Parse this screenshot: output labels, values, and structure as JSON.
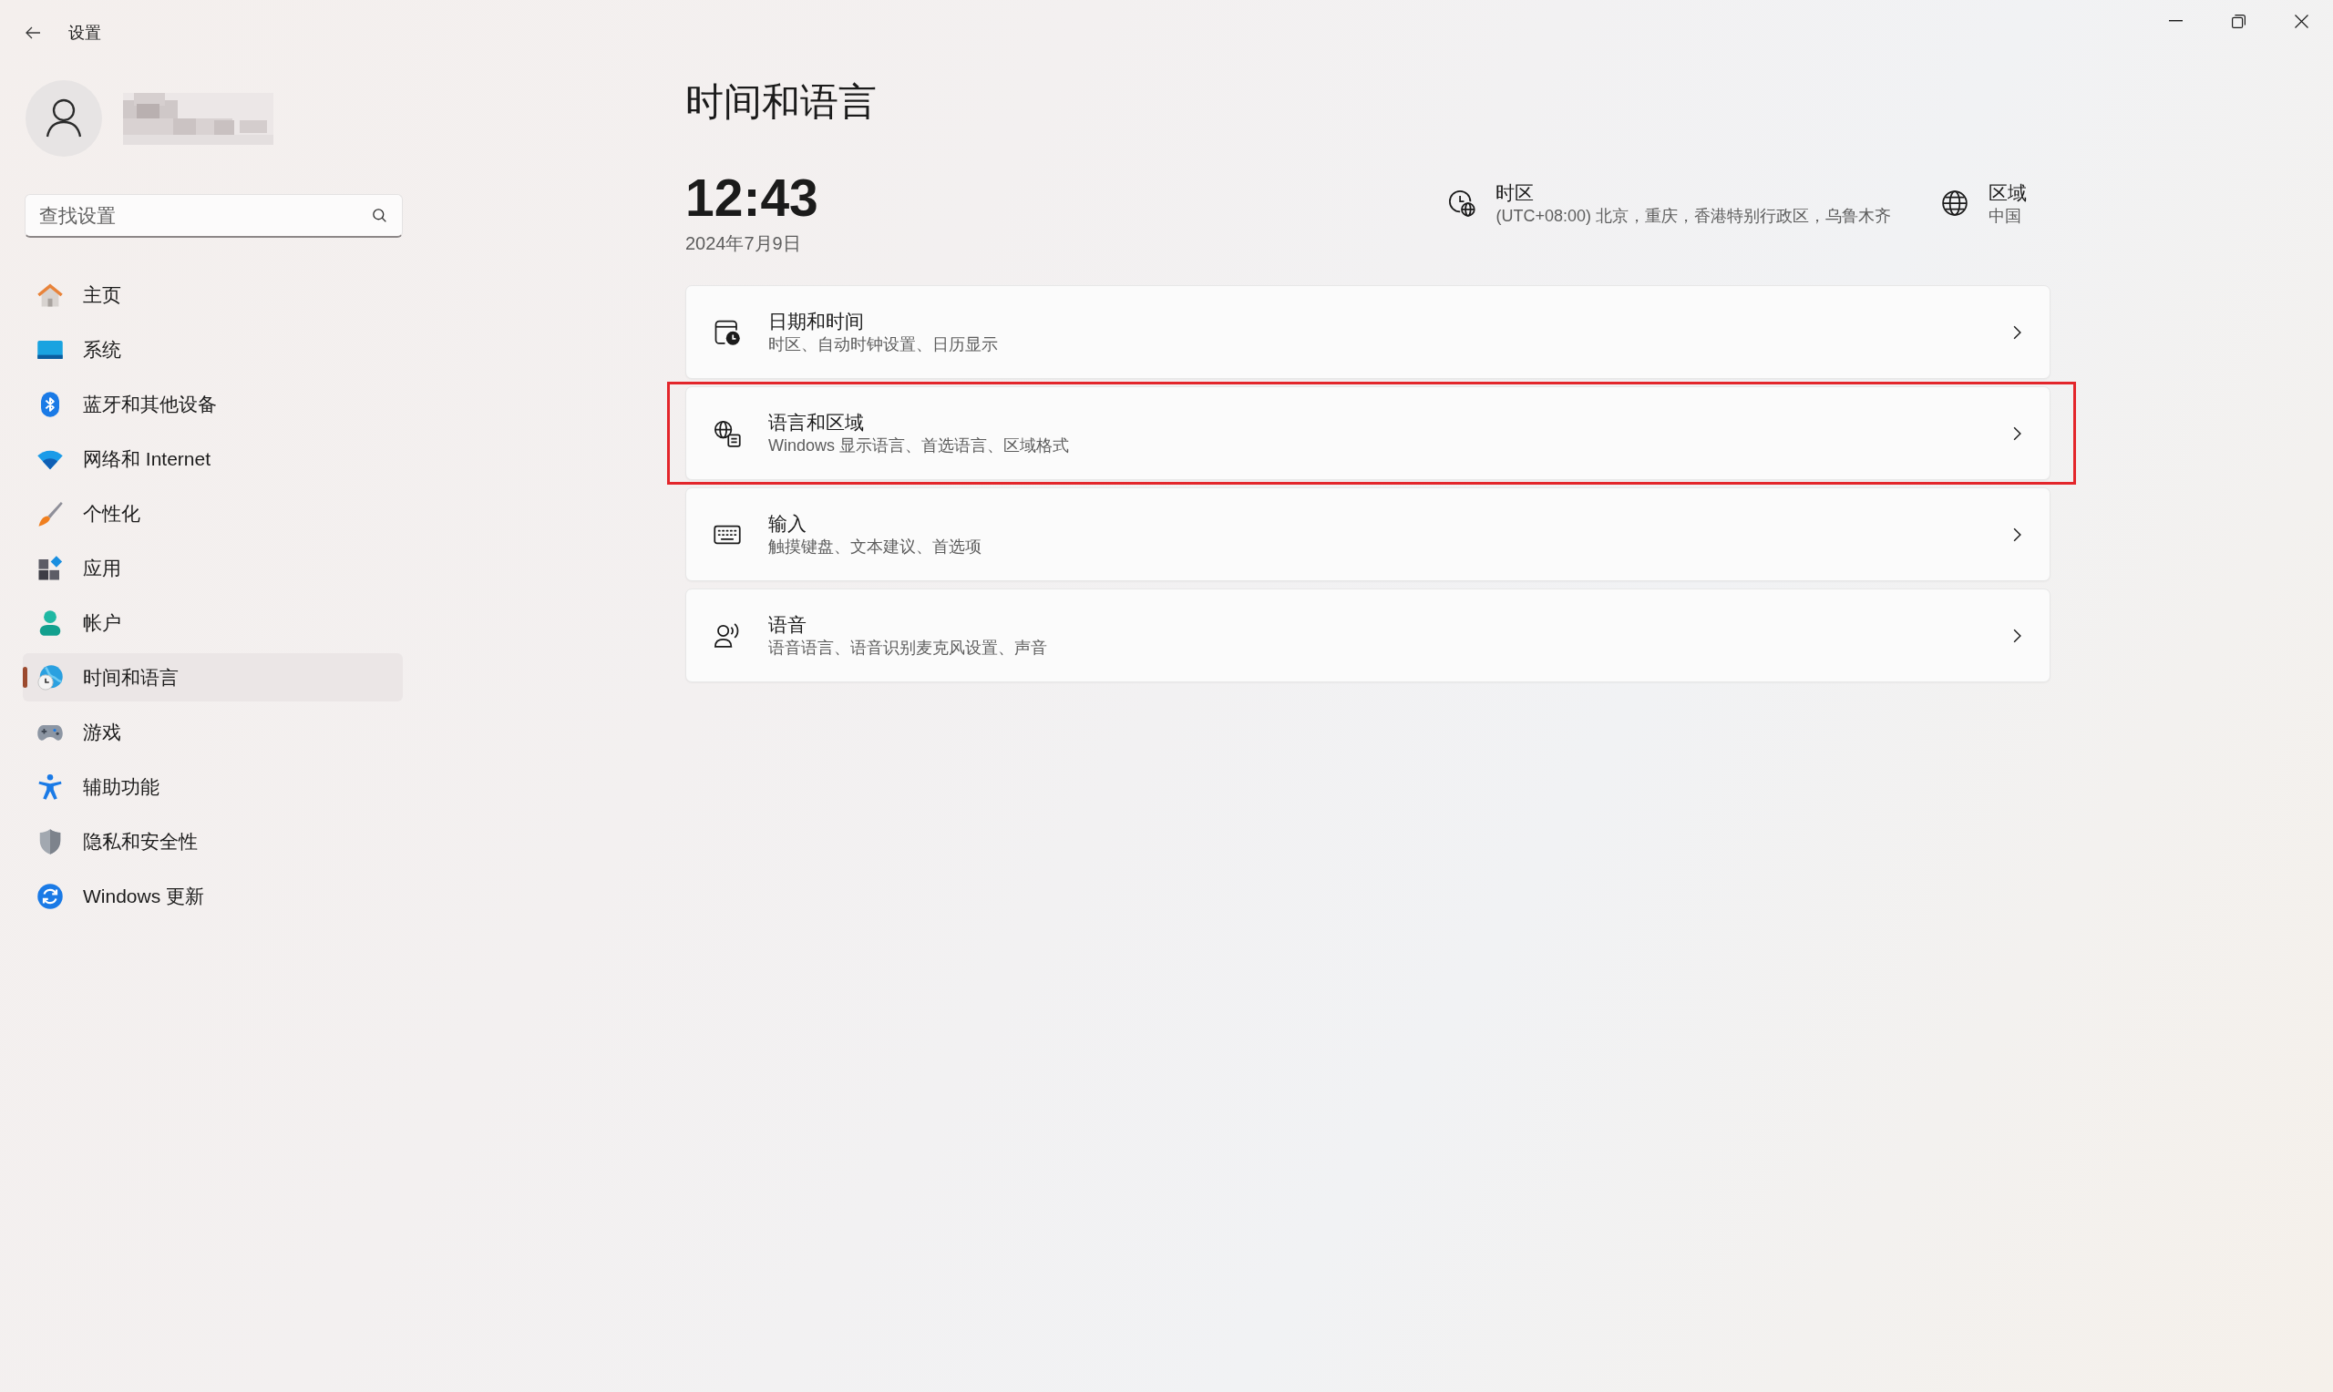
{
  "window": {
    "title": "设置"
  },
  "search": {
    "placeholder": "查找设置"
  },
  "sidebar": {
    "items": [
      {
        "label": "主页",
        "selected": false
      },
      {
        "label": "系统",
        "selected": false
      },
      {
        "label": "蓝牙和其他设备",
        "selected": false
      },
      {
        "label": "网络和 Internet",
        "selected": false
      },
      {
        "label": "个性化",
        "selected": false
      },
      {
        "label": "应用",
        "selected": false
      },
      {
        "label": "帐户",
        "selected": false
      },
      {
        "label": "时间和语言",
        "selected": true
      },
      {
        "label": "游戏",
        "selected": false
      },
      {
        "label": "辅助功能",
        "selected": false
      },
      {
        "label": "隐私和安全性",
        "selected": false
      },
      {
        "label": "Windows 更新",
        "selected": false
      }
    ]
  },
  "page": {
    "title": "时间和语言",
    "time": "12:43",
    "date": "2024年7月9日",
    "info": [
      {
        "label": "时区",
        "value": "(UTC+08:00) 北京，重庆，香港特别行政区，乌鲁木齐"
      },
      {
        "label": "区域",
        "value": "中国"
      }
    ],
    "cards": [
      {
        "title": "日期和时间",
        "subtitle": "时区、自动时钟设置、日历显示",
        "highlighted": false
      },
      {
        "title": "语言和区域",
        "subtitle": "Windows 显示语言、首选语言、区域格式",
        "highlighted": true
      },
      {
        "title": "输入",
        "subtitle": "触摸键盘、文本建议、首选项",
        "highlighted": false
      },
      {
        "title": "语音",
        "subtitle": "语音语言、语音识别麦克风设置、声音",
        "highlighted": false
      }
    ]
  }
}
